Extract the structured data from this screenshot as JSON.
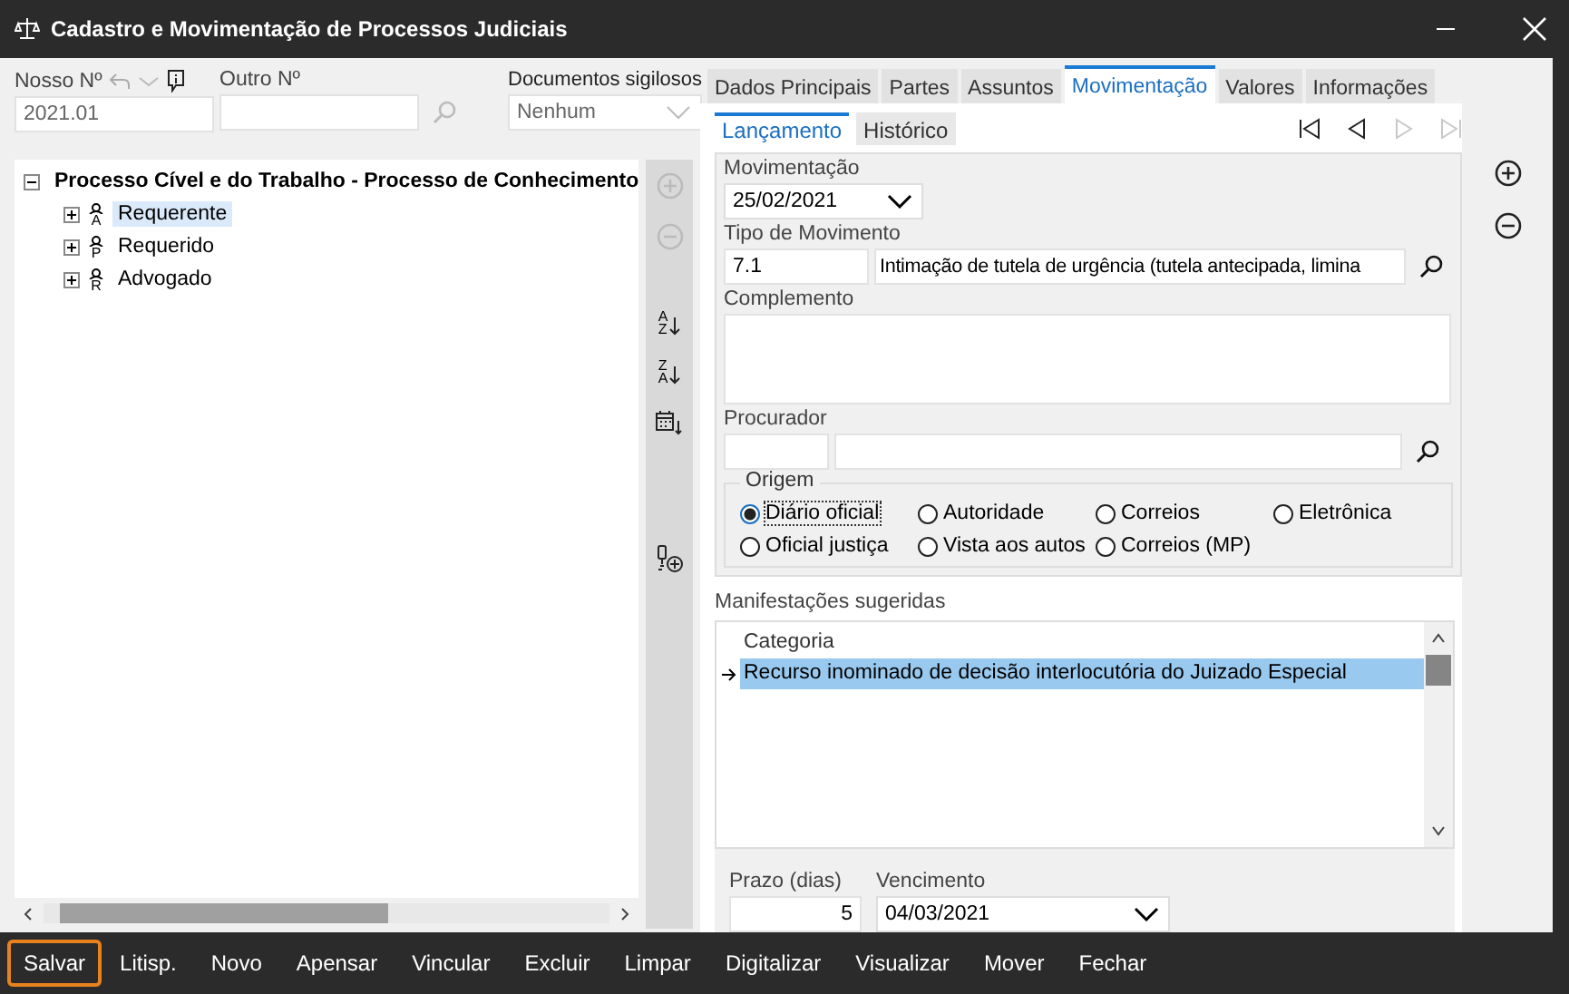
{
  "window": {
    "title": "Cadastro e Movimentação de Processos Judiciais"
  },
  "header": {
    "nosso_numero": {
      "label": "Nosso Nº",
      "value": "2021.01"
    },
    "outro_numero": {
      "label": "Outro Nº"
    },
    "documentos_sigilosos": {
      "label": "Documentos sigilosos",
      "value": "Nenhum"
    }
  },
  "tree": {
    "root": {
      "label": "Processo Cível e do Trabalho - Processo de Conhecimento",
      "expanded": true,
      "children": [
        {
          "label": "Requerente",
          "icon_letter": "A",
          "selected": true,
          "expanded": false
        },
        {
          "label": "Requerido",
          "icon_letter": "P",
          "selected": false,
          "expanded": false
        },
        {
          "label": "Advogado",
          "icon_letter": "R",
          "selected": false,
          "expanded": false
        }
      ]
    }
  },
  "side_tools": [
    {
      "kind": "add",
      "disabled": true
    },
    {
      "kind": "remove",
      "disabled": true
    },
    {
      "kind": "sort",
      "top": "A",
      "bottom": "Z"
    },
    {
      "kind": "sort",
      "top": "Z",
      "bottom": "A"
    },
    {
      "kind": "calendar"
    },
    {
      "kind": "attach"
    }
  ],
  "tabs": [
    {
      "label": "Dados Principais",
      "selected": false
    },
    {
      "label": "Partes",
      "selected": false
    },
    {
      "label": "Assuntos",
      "selected": false
    },
    {
      "label": "Movimentação",
      "selected": true
    },
    {
      "label": "Valores",
      "selected": false
    },
    {
      "label": "Informações",
      "selected": false
    }
  ],
  "subtabs": [
    {
      "label": "Lançamento",
      "selected": true
    },
    {
      "label": "Histórico",
      "selected": false
    }
  ],
  "nav": [
    {
      "kind": "first",
      "disabled": false
    },
    {
      "kind": "prev",
      "disabled": false
    },
    {
      "kind": "next",
      "disabled": true
    },
    {
      "kind": "last",
      "disabled": true
    }
  ],
  "form": {
    "movimentacao": {
      "label": "Movimentação",
      "value": "25/02/2021"
    },
    "tipo_de_movimento": {
      "label": "Tipo de Movimento",
      "code": "7.1",
      "description": "Intimação de tutela de urgência (tutela antecipada, limina"
    },
    "complemento": {
      "label": "Complemento"
    },
    "procurador": {
      "label": "Procurador"
    },
    "origem": {
      "label": "Origem",
      "options": [
        {
          "label": "Diário oficial",
          "selected": true
        },
        {
          "label": "Autoridade",
          "selected": false
        },
        {
          "label": "Correios",
          "selected": false
        },
        {
          "label": "Eletrônica",
          "selected": false
        },
        {
          "label": "Oficial justiça",
          "selected": false
        },
        {
          "label": "Vista aos autos",
          "selected": false
        },
        {
          "label": "Correios (MP)",
          "selected": false
        }
      ]
    }
  },
  "manifestacoes": {
    "label": "Manifestações sugeridas",
    "column": "Categoria",
    "rows": [
      {
        "text": "Recurso inominado de decisão interlocutória do Juizado Especial",
        "selected": true
      }
    ]
  },
  "prazo": {
    "label": "Prazo (dias)",
    "value": "5"
  },
  "vencimento": {
    "label": "Vencimento",
    "value": "04/03/2021"
  },
  "toolbar": [
    {
      "label": "Salvar",
      "focused": true
    },
    {
      "label": "Litisp.",
      "focused": false
    },
    {
      "label": "Novo",
      "focused": false
    },
    {
      "label": "Apensar",
      "focused": false
    },
    {
      "label": "Vincular",
      "focused": false
    },
    {
      "label": "Excluir",
      "focused": false
    },
    {
      "label": "Limpar",
      "focused": false
    },
    {
      "label": "Digitalizar",
      "focused": false
    },
    {
      "label": "Visualizar",
      "focused": false
    },
    {
      "label": "Mover",
      "focused": false
    },
    {
      "label": "Fechar",
      "focused": false
    }
  ]
}
